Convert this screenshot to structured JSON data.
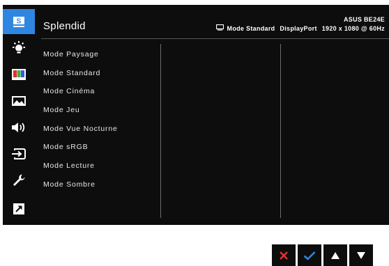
{
  "header": {
    "title": "Splendid",
    "model": "ASUS BE24E",
    "current_mode": "Mode Standard",
    "input": "DisplayPort",
    "resolution": "1920 x 1080 @ 60Hz"
  },
  "sidebar": {
    "items": [
      {
        "icon": "splendid-icon",
        "label": "S",
        "active": true
      },
      {
        "icon": "brightness-icon",
        "active": false
      },
      {
        "icon": "color-icon",
        "active": false
      },
      {
        "icon": "image-icon",
        "active": false
      },
      {
        "icon": "sound-icon",
        "active": false
      },
      {
        "icon": "input-select-icon",
        "active": false
      },
      {
        "icon": "system-setup-icon",
        "active": false
      },
      {
        "icon": "shortcut-icon",
        "active": false
      }
    ]
  },
  "menu": {
    "items": [
      "Mode Paysage",
      "Mode Standard",
      "Mode Cinéma",
      "Mode Jeu",
      "Mode Vue Nocturne",
      "Mode sRGB",
      "Mode Lecture",
      "Mode Sombre"
    ]
  },
  "nav_buttons": [
    {
      "icon": "close-icon",
      "color": "#e0332e"
    },
    {
      "icon": "check-icon",
      "color": "#2f86e0"
    },
    {
      "icon": "arrow-up-icon",
      "color": "#ffffff"
    },
    {
      "icon": "arrow-down-icon",
      "color": "#ffffff"
    }
  ],
  "colors": {
    "accent": "#2f86e0",
    "background": "#0d0d0d",
    "text": "#ffffff"
  }
}
